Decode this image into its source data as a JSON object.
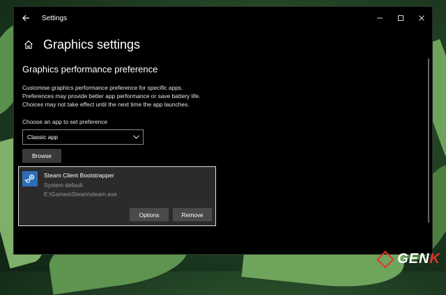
{
  "window": {
    "title": "Settings"
  },
  "header": {
    "title": "Graphics settings"
  },
  "section": {
    "title": "Graphics performance preference",
    "description_lines": [
      "Customise graphics performance preference for specific apps.",
      "Preferences may provide better app performance or save battery life.",
      "Choices may not take effect until the next time the app launches."
    ]
  },
  "chooser": {
    "label": "Choose an app to set preference",
    "selected": "Classic app",
    "browse_label": "Browse"
  },
  "app_entry": {
    "name": "Steam Client Bootstrapper",
    "setting": "System default",
    "path": "E:\\Games\\Steam\\steam.exe",
    "options_label": "Options",
    "remove_label": "Remove"
  },
  "watermark": {
    "text_a": "GEN",
    "text_b": "K"
  },
  "colors": {
    "steam_icon": "#2a6fb6",
    "accent": "#e7332a"
  }
}
